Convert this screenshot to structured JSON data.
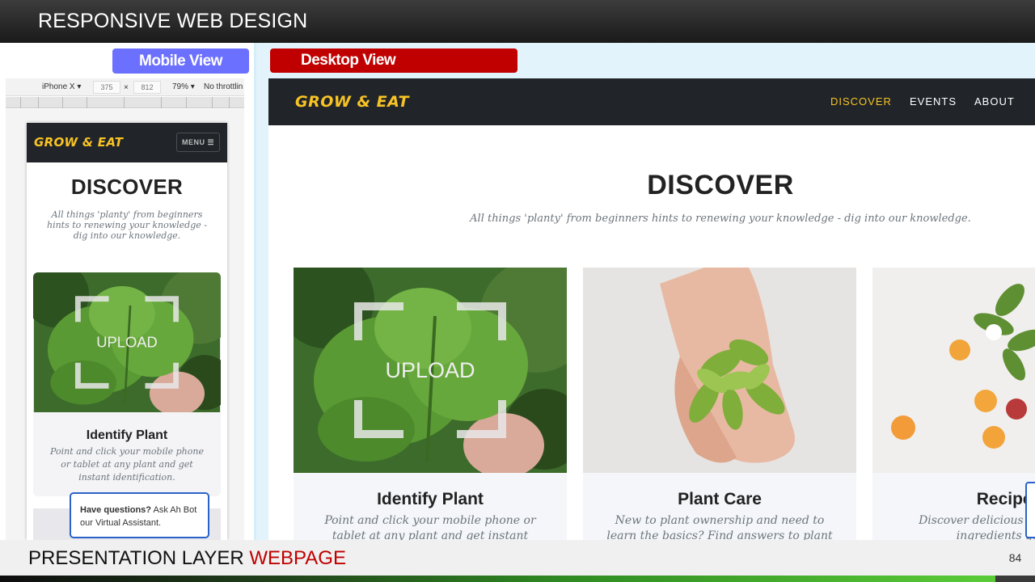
{
  "header": {
    "title": "RESPONSIVE WEB DESIGN"
  },
  "labels": {
    "mobile": "Mobile View",
    "desktop": "Desktop View"
  },
  "devtools": {
    "device": "iPhone X ▾",
    "width": "375",
    "times": "×",
    "height": "812",
    "zoom": "79% ▾",
    "throttle": "No throttlin"
  },
  "mobile": {
    "brand": "GROW & EAT",
    "menu_label": "MENU ☰",
    "title": "DISCOVER",
    "subtitle": "All things 'planty' from beginners hints to renewing your knowledge - dig into our knowledge.",
    "card": {
      "upload_label": "UPLOAD",
      "title": "Identify Plant",
      "text": "Point and click your mobile phone or tablet at any plant and get instant identification."
    },
    "chat": {
      "bold": "Have questions?",
      "rest": " Ask Ah Bot our Virtual Assistant."
    }
  },
  "desktop": {
    "brand": "GROW & EAT",
    "nav": [
      "DISCOVER",
      "EVENTS",
      "ABOUT"
    ],
    "title": "DISCOVER",
    "subtitle": "All things 'planty' from beginners hints to renewing your knowledge - dig into our knowledge.",
    "cards": [
      {
        "title": "Identify Plant",
        "text": "Point and click your mobile phone or tablet at any plant and get instant identification.",
        "upload_label": "UPLOAD"
      },
      {
        "title": "Plant Care",
        "text": "New to plant ownership and need to learn the basics? Find answers to plant care questions."
      },
      {
        "title": "Recipes",
        "text": "Discover delicious recipes from ingredients grown"
      }
    ]
  },
  "footer": {
    "title_main": "PRESENTATION LAYER ",
    "title_accent": "WEBPAGE",
    "page_number": "84"
  },
  "colors": {
    "accent_red": "#c00000",
    "accent_blue": "#6c70ff",
    "brand_yellow": "#f7c325",
    "nav_dark": "#212529",
    "chat_border": "#2a62c9"
  }
}
